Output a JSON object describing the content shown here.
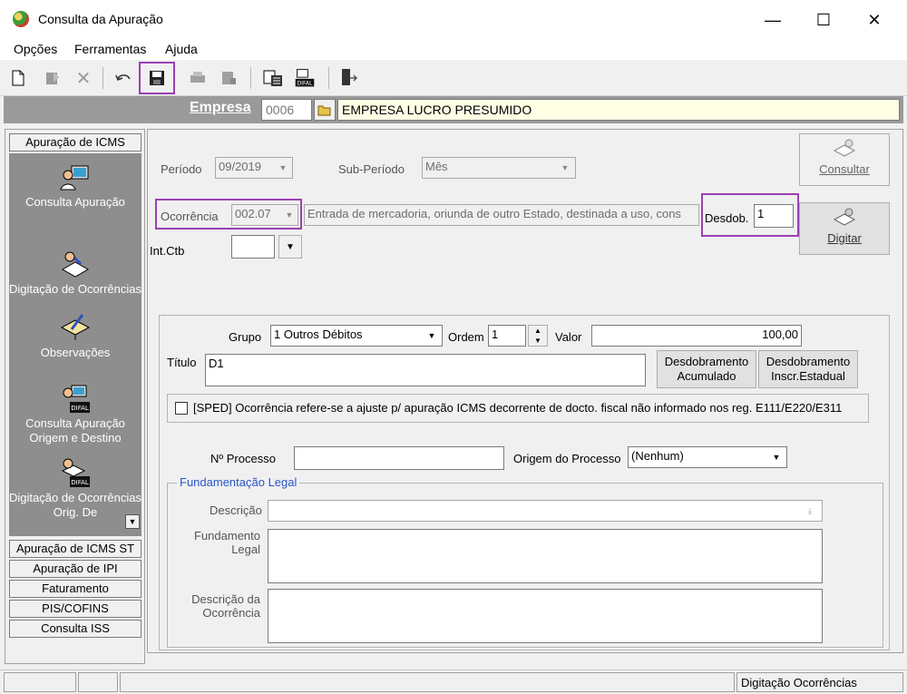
{
  "window": {
    "title": "Consulta da Apuração",
    "minimize": "—",
    "maximize": "☐",
    "close": "✕"
  },
  "menu": {
    "items": [
      "Opções",
      "Ferramentas",
      "Ajuda"
    ]
  },
  "empresa": {
    "label": "Empresa",
    "code": "0006",
    "name": "EMPRESA LUCRO PRESUMIDO"
  },
  "sidebar": {
    "top_group": "Apuração de ICMS",
    "items": [
      {
        "label": "Consulta Apuração"
      },
      {
        "label": "Digitação de Ocorrências"
      },
      {
        "label": "Observações"
      },
      {
        "label": "Consulta Apuração Origem e Destino",
        "badge": "DIFAL"
      },
      {
        "label": "Digitação de Ocorrências Orig. De",
        "badge": "DIFAL"
      }
    ],
    "bottom_groups": [
      "Apuração de ICMS ST",
      "Apuração de IPI",
      "Faturamento",
      "PIS/COFINS",
      "Consulta ISS"
    ]
  },
  "form": {
    "periodo_label": "Período",
    "periodo_value": "09/2019",
    "subperiodo_label": "Sub-Período",
    "subperiodo_value": "Mês",
    "consultar_label": "Consultar",
    "ocorrencia_label": "Ocorrência",
    "ocorrencia_code": "002.07",
    "ocorrencia_desc": "Entrada de mercadoria, oriunda de outro Estado, destinada a uso, cons",
    "desdob_label": "Desdob.",
    "desdob_value": "1",
    "digitar_label": "Digitar",
    "intctb_label": "Int.Ctb",
    "intctb_value": ""
  },
  "detail": {
    "grupo_label": "Grupo",
    "grupo_value": "1  Outros Débitos",
    "ordem_label": "Ordem",
    "ordem_value": "1",
    "valor_label": "Valor",
    "valor_value": "100,00",
    "titulo_label": "Título",
    "titulo_value": "D1",
    "btn_acumulado_1": "Desdobramento",
    "btn_acumulado_2": "Acumulado",
    "btn_estadual_1": "Desdobramento",
    "btn_estadual_2": "Inscr.Estadual",
    "sped_label": "[SPED] Ocorrência refere-se a ajuste p/ apuração ICMS decorrente de docto. fiscal não informado nos reg. E111/E220/E311",
    "sped_checked": false,
    "processo_label": "Nº Processo",
    "processo_value": "",
    "origem_label": "Origem do Processo",
    "origem_value": "(Nenhum)",
    "fund_group_label": "Fundamentação Legal",
    "descricao_label": "Descrição",
    "fundamento_label_1": "Fundamento",
    "fundamento_label_2": "Legal",
    "descocorr_label_1": "Descrição da",
    "descocorr_label_2": "Ocorrência"
  },
  "status": {
    "text": "Digitação Ocorrências"
  },
  "colors": {
    "highlight": "#9b3fb4",
    "panel_gray": "#8e8e8e",
    "empresa_name_bg": "#ffffe6"
  }
}
